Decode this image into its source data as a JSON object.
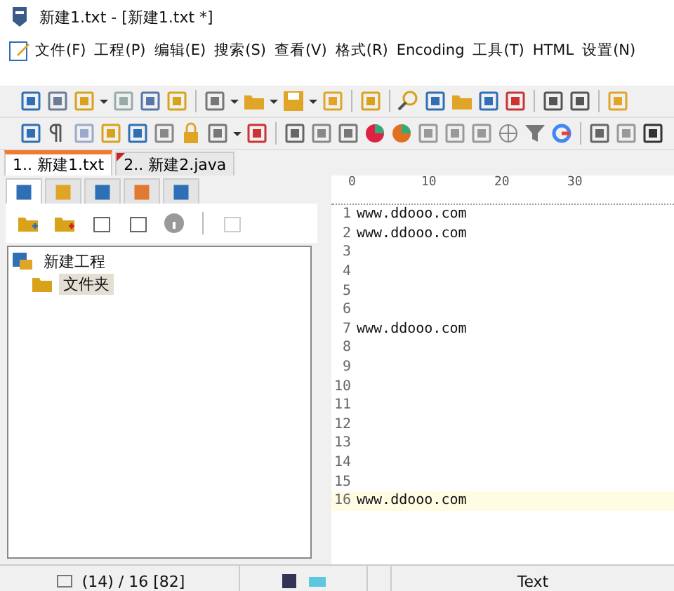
{
  "window": {
    "title": "新建1.txt - [新建1.txt *]"
  },
  "menu": [
    "文件(F)",
    "工程(P)",
    "编辑(E)",
    "搜索(S)",
    "查看(V)",
    "格式(R)",
    "Encoding",
    "工具(T)",
    "HTML",
    "设置(N)"
  ],
  "doc_tabs": [
    {
      "label": "1.. 新建1.txt",
      "selected": true
    },
    {
      "label": "2.. 新建2.java",
      "selected": false
    }
  ],
  "panel_tabs": [
    {
      "selected": true
    },
    {
      "selected": false
    },
    {
      "selected": false
    },
    {
      "selected": false
    },
    {
      "selected": false
    }
  ],
  "tree": [
    {
      "label": "新建工程",
      "selected": false,
      "children": [
        {
          "label": "文件夹",
          "selected": true
        }
      ]
    }
  ],
  "ruler": [
    "0",
    "10",
    "20",
    "30"
  ],
  "lines": [
    {
      "number": "1",
      "text": "www.ddooo.com",
      "current": false
    },
    {
      "number": "2",
      "text": "www.ddooo.com",
      "current": false
    },
    {
      "number": "3",
      "current": false
    },
    {
      "number": "4",
      "current": false
    },
    {
      "number": "5",
      "current": false
    },
    {
      "number": "6",
      "current": false
    },
    {
      "number": "7",
      "text": "www.ddooo.com",
      "current": false
    },
    {
      "number": "8",
      "current": false
    },
    {
      "number": "9",
      "current": false
    },
    {
      "number": "10",
      "current": false
    },
    {
      "number": "11",
      "current": false
    },
    {
      "number": "12",
      "current": false
    },
    {
      "number": "13",
      "current": false
    },
    {
      "number": "14",
      "current": false
    },
    {
      "number": "15",
      "current": false
    },
    {
      "number": "16",
      "text": "www.ddooo.com",
      "current": true
    }
  ],
  "status_bar": {
    "position": "(14) / 16  [82]",
    "mode": "Text"
  }
}
